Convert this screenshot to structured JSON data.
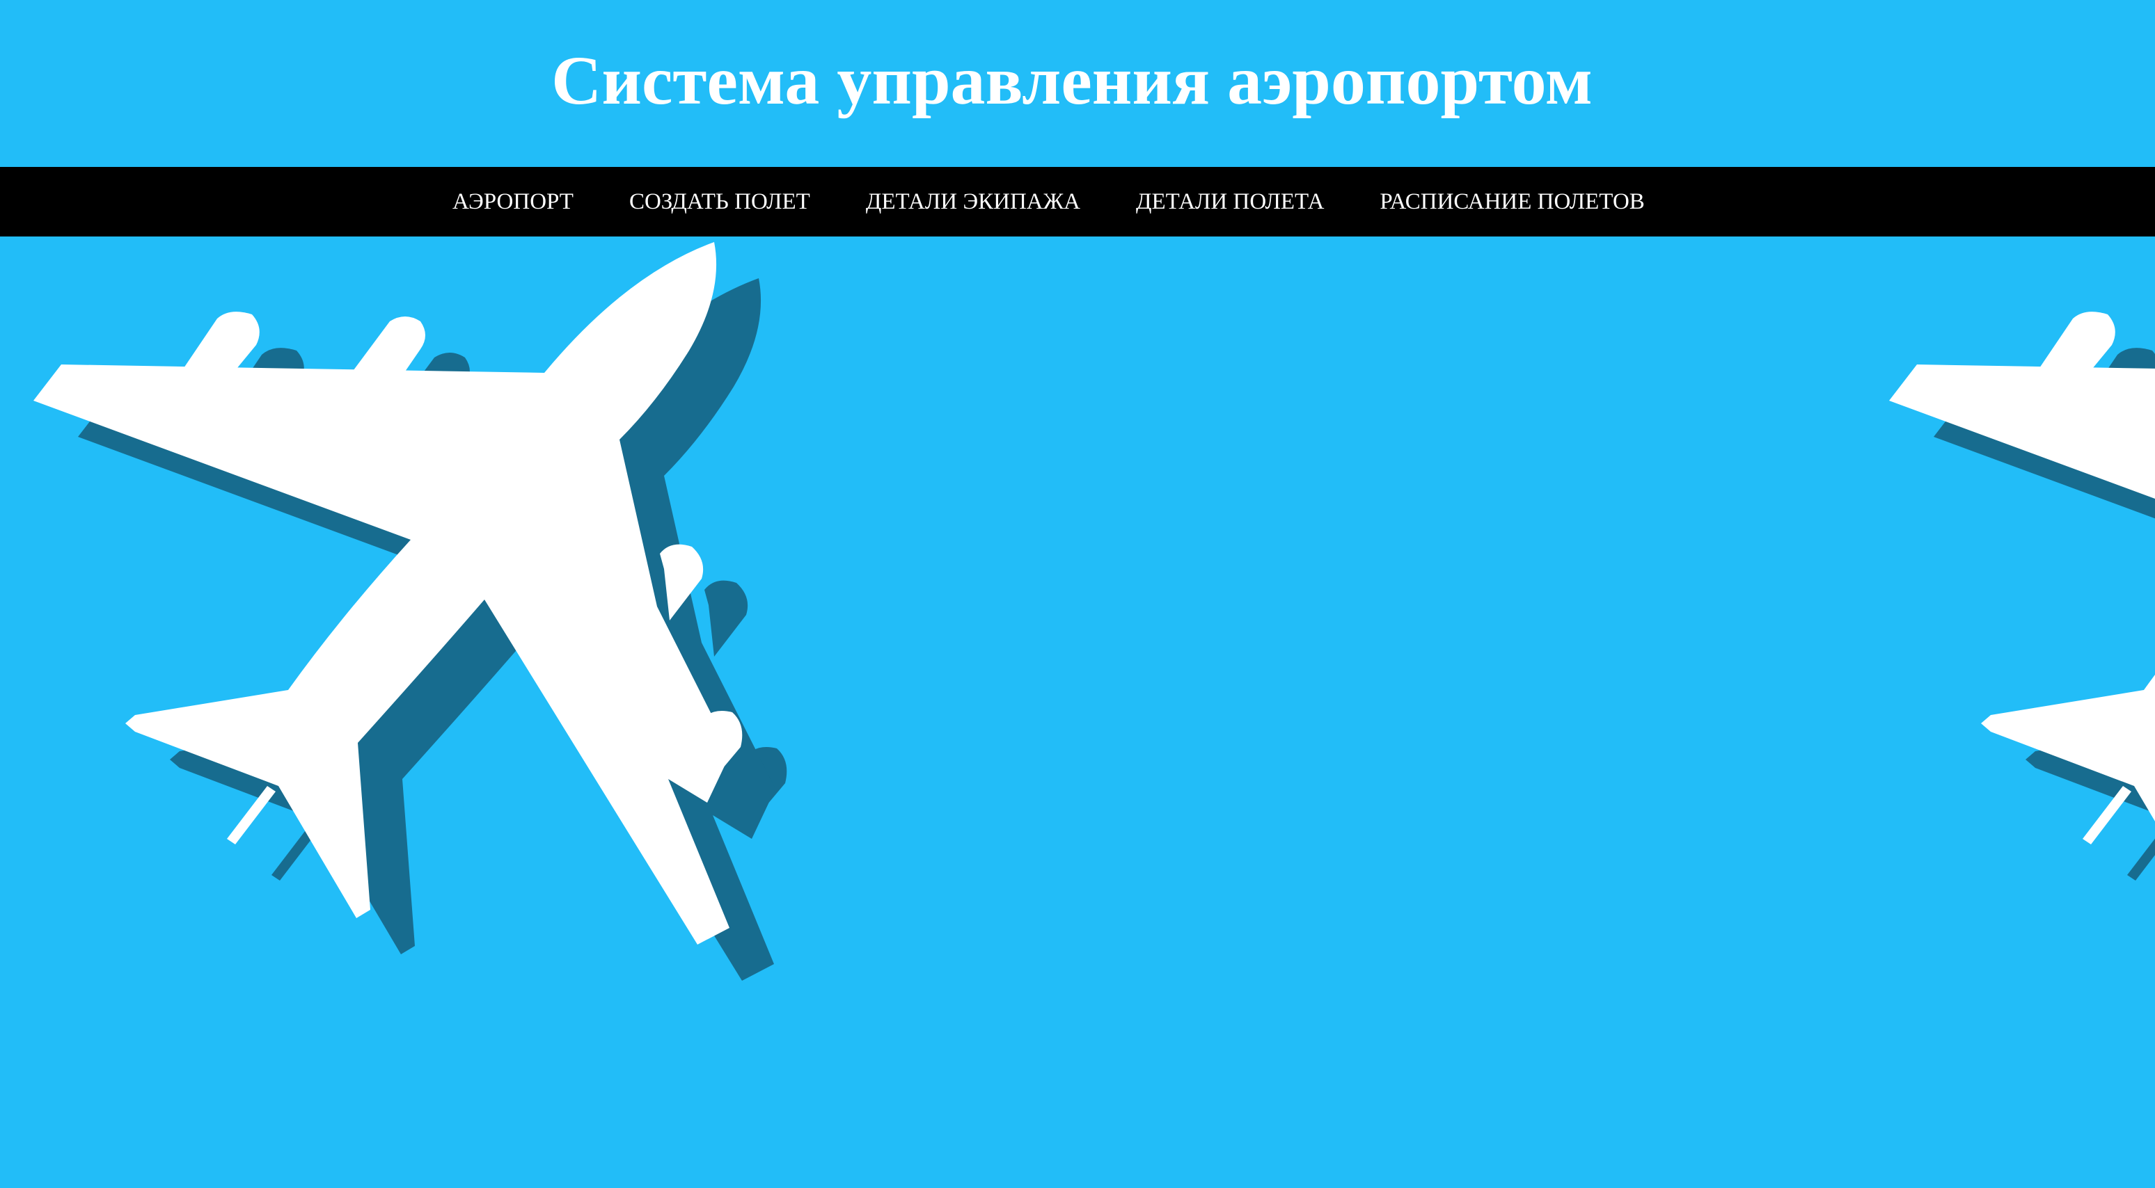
{
  "header": {
    "title": "Система управления аэропортом"
  },
  "nav": {
    "items": [
      {
        "label": "АЭРОПОРТ"
      },
      {
        "label": "СОЗДАТЬ ПОЛЕТ"
      },
      {
        "label": "ДЕТАЛИ ЭКИПАЖА"
      },
      {
        "label": "ДЕТАЛИ ПОЛЕТА"
      },
      {
        "label": "РАСПИСАНИЕ ПОЛЕТОВ"
      }
    ]
  },
  "colors": {
    "background": "#22bdf8",
    "navbar": "#000000",
    "text": "#ffffff",
    "plane": "#ffffff",
    "plane_shadow": "#176c8f"
  },
  "background_image": {
    "icon": "airplane-icon",
    "description_visible": false
  }
}
